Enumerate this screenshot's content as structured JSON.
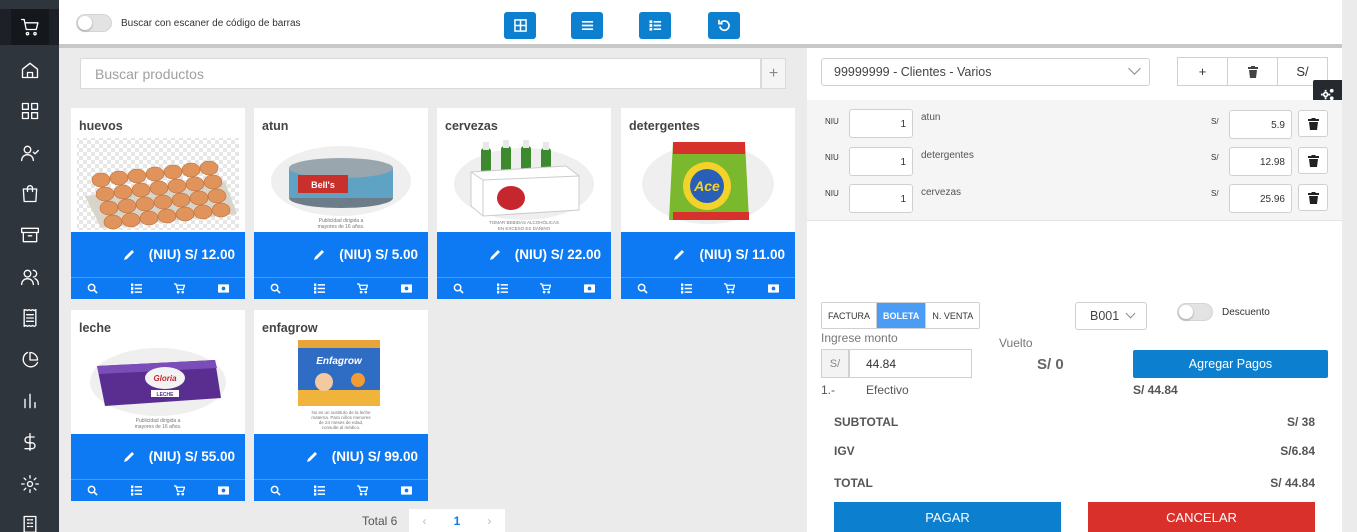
{
  "sidebar": {
    "items": [
      {
        "icon": "cart-icon",
        "active": true
      },
      {
        "icon": "home-icon"
      },
      {
        "icon": "grid-icon"
      },
      {
        "icon": "user-check-icon"
      },
      {
        "icon": "shopping-bag-icon"
      },
      {
        "icon": "archive-icon"
      },
      {
        "icon": "users-icon"
      },
      {
        "icon": "receipt-icon"
      },
      {
        "icon": "pie-chart-icon"
      },
      {
        "icon": "bar-chart-icon"
      },
      {
        "icon": "dollar-icon"
      },
      {
        "icon": "settings-icon"
      },
      {
        "icon": "building-icon"
      }
    ]
  },
  "topbar": {
    "barcode_toggle_label": "Buscar con escaner de código de barras",
    "barcode_toggle_on": false,
    "view_buttons": [
      "grid-view-icon",
      "list-view-icon",
      "detail-list-icon",
      "refresh-icon"
    ]
  },
  "search": {
    "placeholder": "Buscar productos",
    "add_label": "+"
  },
  "products": [
    {
      "name": "huevos",
      "price": "(NIU) S/ 12.00",
      "image": "eggs-tray"
    },
    {
      "name": "atun",
      "price": "(NIU) S/ 5.00",
      "image": "tuna-can",
      "note": "Publicidad dirigida a mayores de 16 años."
    },
    {
      "name": "cervezas",
      "price": "(NIU) S/ 22.00",
      "image": "beer-pack",
      "note": "TOMAR BEBIDAS ALCOHÓLICAS EN EXCESO ES DAÑINO"
    },
    {
      "name": "detergentes",
      "price": "(NIU) S/ 11.00",
      "image": "detergent-bag",
      "brand": "Ace"
    },
    {
      "name": "leche",
      "price": "(NIU) S/ 55.00",
      "image": "milk-cans",
      "brand": "Gloria",
      "note": "Publicidad dirigida a mayores de 16 años."
    },
    {
      "name": "enfagrow",
      "price": "(NIU) S/ 99.00",
      "image": "formula-can",
      "brand": "Enfagrow",
      "note": "No es un sustituto de la leche materna. Para niños menores de 24 meses de edad, consulte al médico."
    }
  ],
  "pagination": {
    "total": "Total 6",
    "page": "1",
    "prev": "‹",
    "next": "›"
  },
  "client": {
    "selected": "99999999 - Clientes - Varios",
    "buttons": [
      "+",
      "trash-icon",
      "S/"
    ]
  },
  "cart_lines": [
    {
      "unit": "NIU",
      "qty": "1",
      "name": "atun",
      "currency": "S/",
      "price": "5.9"
    },
    {
      "unit": "NIU",
      "qty": "1",
      "name": "detergentes",
      "currency": "S/",
      "price": "12.98"
    },
    {
      "unit": "NIU",
      "qty": "1",
      "name": "cervezas",
      "currency": "S/",
      "price": "25.96"
    }
  ],
  "document": {
    "types": [
      "FACTURA",
      "BOLETA",
      "N. VENTA"
    ],
    "active_type": "BOLETA",
    "serie": "B001",
    "discount_label": "Descuento"
  },
  "payment": {
    "amount_label": "Ingrese monto",
    "currency_prefix": "S/",
    "amount": "44.84",
    "vuelto_label": "Vuelto",
    "vuelto": "S/ 0",
    "add_payments": "Agregar Pagos",
    "row_index": "1.-",
    "row_method": "Efectivo",
    "row_amount": "S/ 44.84"
  },
  "summary": {
    "subtotal_label": "SUBTOTAL",
    "subtotal": "S/ 38",
    "igv_label": "IGV",
    "igv": "S/6.84",
    "total_label": "TOTAL",
    "total": "S/ 44.84"
  },
  "actions": {
    "pay": "PAGAR",
    "cancel": "CANCELAR"
  },
  "colors": {
    "accent": "#0d79f2",
    "primary_button": "#0d7fcf",
    "danger": "#d9302c",
    "sidebar": "#2f353d"
  }
}
